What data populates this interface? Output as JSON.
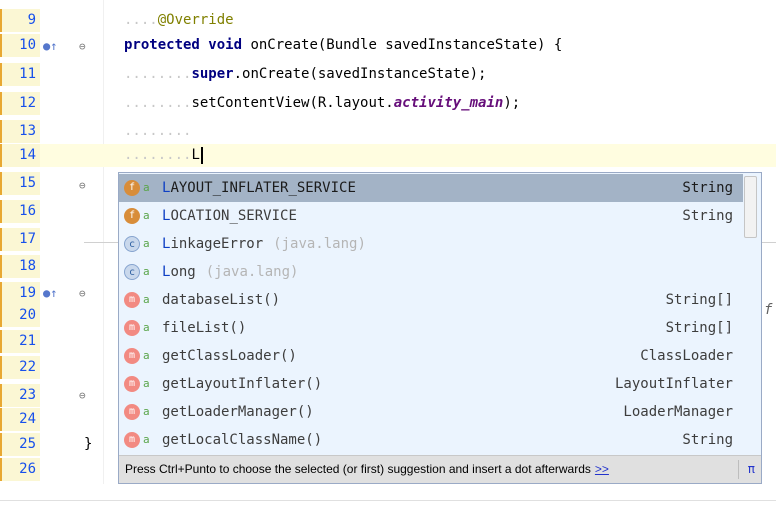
{
  "editor": {
    "lines": [
      {
        "num": "9"
      },
      {
        "num": "10"
      },
      {
        "num": "11"
      },
      {
        "num": "12"
      },
      {
        "num": "13"
      },
      {
        "num": "14"
      },
      {
        "num": "15"
      },
      {
        "num": "16"
      },
      {
        "num": "17"
      },
      {
        "num": "18"
      },
      {
        "num": "19"
      },
      {
        "num": "20"
      },
      {
        "num": "21"
      },
      {
        "num": "22"
      },
      {
        "num": "23"
      },
      {
        "num": "24"
      },
      {
        "num": "25"
      },
      {
        "num": "26"
      }
    ],
    "code": {
      "l9_anno": "@Override",
      "l10_kw": "protected void",
      "l10_rest": " onCreate(Bundle savedInstanceState) {",
      "l11_kw": "super",
      "l11_rest": ".onCreate(savedInstanceState);",
      "l12_pre": "setContentView(R.layout.",
      "l12_it": "activity_main",
      "l12_post": ");",
      "l14_typed": "L",
      "l25_brace": "}"
    },
    "right_fragment": "f"
  },
  "autocomplete": {
    "items": [
      {
        "icon": "field-icon",
        "name_hl": "L",
        "name_rest": "AYOUT_INFLATER_SERVICE",
        "pkg": "",
        "type": "String"
      },
      {
        "icon": "field-icon",
        "name_hl": "L",
        "name_rest": "OCATION_SERVICE",
        "pkg": "",
        "type": "String"
      },
      {
        "icon": "class-icon",
        "name_hl": "L",
        "name_rest": "inkageError",
        "pkg": "(java.lang)",
        "type": ""
      },
      {
        "icon": "class-icon",
        "name_hl": "L",
        "name_rest": "ong",
        "pkg": "(java.lang)",
        "type": ""
      },
      {
        "icon": "method-icon",
        "name_hl": "",
        "name_rest": "databaseList()",
        "pkg": "",
        "type": "String[]"
      },
      {
        "icon": "method-icon",
        "name_hl": "",
        "name_rest": "fileList()",
        "pkg": "",
        "type": "String[]"
      },
      {
        "icon": "method-icon",
        "name_hl": "",
        "name_rest": "getClassLoader()",
        "pkg": "",
        "type": "ClassLoader"
      },
      {
        "icon": "method-icon",
        "name_hl": "",
        "name_rest": "getLayoutInflater()",
        "pkg": "",
        "type": "LayoutInflater"
      },
      {
        "icon": "method-icon",
        "name_hl": "",
        "name_rest": "getLoaderManager()",
        "pkg": "",
        "type": "LoaderManager"
      },
      {
        "icon": "method-icon",
        "name_hl": "",
        "name_rest": "getLocalClassName()",
        "pkg": "",
        "type": "String"
      }
    ],
    "hint_text": "Press Ctrl+Punto to choose the selected (or first) suggestion and insert a dot afterwards",
    "hint_link": ">>",
    "hint_pi": "π"
  }
}
